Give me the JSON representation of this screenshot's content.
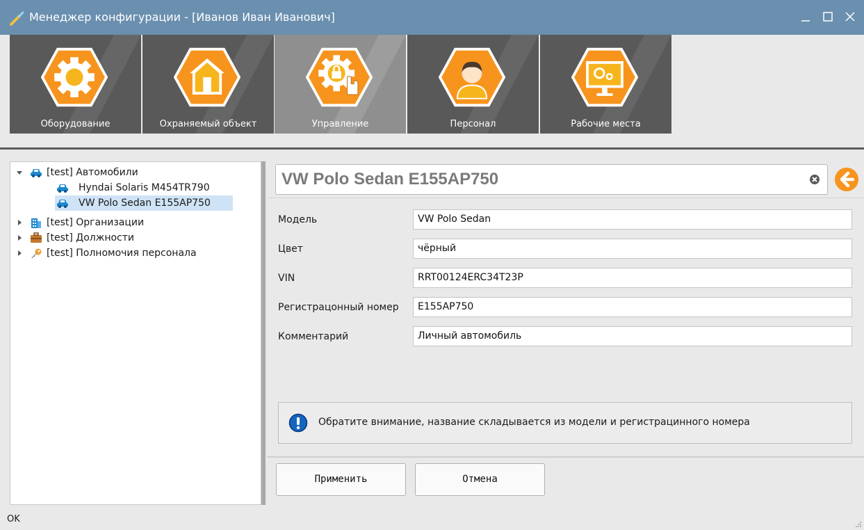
{
  "window": {
    "title": "Менеджер конфигурации - [Иванов Иван Иванович]",
    "controls": [
      "minimize-icon",
      "maximize-icon",
      "close-icon"
    ]
  },
  "ribbon": {
    "tabs": [
      {
        "label": "Оборудование",
        "icon": "gear-icon",
        "active": false
      },
      {
        "label": "Охраняемый объект",
        "icon": "house-icon",
        "active": false
      },
      {
        "label": "Управление",
        "icon": "lock-gear-hand-icon",
        "active": true
      },
      {
        "label": "Персонал",
        "icon": "person-icon",
        "active": false
      },
      {
        "label": "Рабочие места",
        "icon": "monitor-icon",
        "active": false
      }
    ],
    "colors": {
      "accent": "#f7941d",
      "tile": "#595959",
      "tile_active": "#8f8f8f"
    }
  },
  "tree": {
    "items": [
      {
        "label": "[test] Автомобили",
        "icon": "car-icon",
        "expanded": true
      },
      {
        "label": "Hyndai Solaris M454TR790",
        "icon": "car-icon"
      },
      {
        "label": "VW Polo Sedan  E155AP750",
        "icon": "car-icon",
        "selected": true
      },
      {
        "label": "[test] Организации",
        "icon": "building-icon",
        "expanded": false
      },
      {
        "label": "[test] Должности",
        "icon": "briefcase-icon",
        "expanded": false
      },
      {
        "label": "[test] Полномочия персонала",
        "icon": "key-icon",
        "expanded": false
      }
    ]
  },
  "detail": {
    "title": "VW Polo Sedan  E155AP750",
    "fields": [
      {
        "label": "Модель",
        "value": "VW Polo Sedan"
      },
      {
        "label": "Цвет",
        "value": "чёрный"
      },
      {
        "label": "VIN",
        "value": "RRT00124ERC34T23P"
      },
      {
        "label": "Регистрацонный номер",
        "value": "E155AP750"
      },
      {
        "label": "Комментарий",
        "value": "Личный автомобиль"
      }
    ],
    "notice": "Обратите внимание, название складывается из модели и регистрацинного номера"
  },
  "buttons": {
    "apply": "Применить",
    "cancel": "Отмена"
  },
  "status": {
    "text": "OK"
  }
}
